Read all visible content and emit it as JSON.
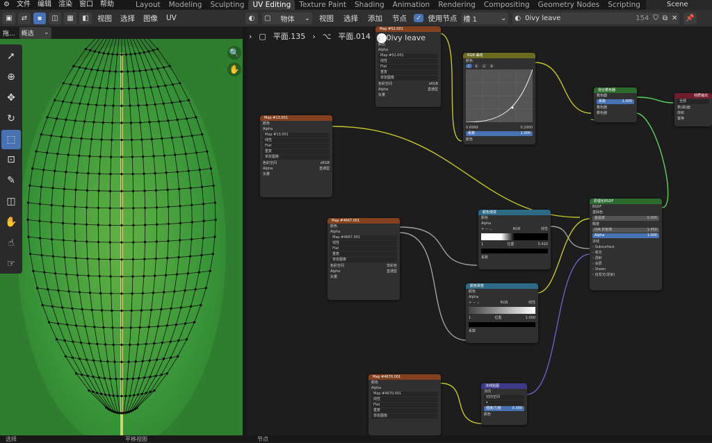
{
  "menu": {
    "items": [
      "文件",
      "编辑",
      "渲染",
      "窗口",
      "帮助"
    ]
  },
  "workspaces": [
    "Layout",
    "Modeling",
    "Sculpting",
    "UV Editing",
    "Texture Paint",
    "Shading",
    "Animation",
    "Rendering",
    "Compositing",
    "Geometry Nodes",
    "Scripting"
  ],
  "active_workspace": "UV Editing",
  "add_tab": "+",
  "scene": "Scene",
  "uv_header": {
    "menus": [
      "视图",
      "选择",
      "图像",
      "UV"
    ]
  },
  "uv_sub": {
    "drag": "拖...",
    "select_mode": "概选"
  },
  "node_header": {
    "object_mode": "物体",
    "menus": [
      "视图",
      "选择",
      "添加",
      "节点"
    ],
    "use_nodes": "使用节点",
    "slot": "槽 1",
    "material": "0ivy leave",
    "users": "154"
  },
  "breadcrumb": {
    "object": "平面.135",
    "mesh": "平面.014",
    "material": "0ivy leave"
  },
  "nodes": {
    "map52": {
      "title": "Map #52.001",
      "image": "Map #52.001",
      "outputs": [
        "颜色",
        "Alpha"
      ],
      "rows": [
        "线性",
        "Flat",
        "重复",
        "单张图像"
      ],
      "colorspace_label": "色彩空间",
      "colorspace": "sRGB",
      "alpha_label": "Alpha",
      "alpha": "直通型",
      "vec": "矢量"
    },
    "rgbcurve": {
      "title": "RGB 曲线",
      "out": "颜色",
      "pos_x": "0.6999",
      "pos_y": "0.2900",
      "fac_label": "系数",
      "fac": "1.000",
      "in": "颜色",
      "channels": [
        "C",
        "R",
        "G",
        "B"
      ]
    },
    "map13": {
      "title": "Map #13.001",
      "image": "Map #13.001",
      "outputs": [
        "颜色",
        "Alpha"
      ],
      "rows": [
        "线性",
        "Flat",
        "重复",
        "单张图像"
      ],
      "colorspace_label": "色彩空间",
      "colorspace": "sRGB",
      "alpha_label": "Alpha",
      "alpha": "直通型",
      "vec": "矢量"
    },
    "mix": {
      "title": "混合着色器",
      "out": "着色器",
      "fac_label": "系数",
      "fac": "1.000",
      "in1": "着色器",
      "in2": "着色器"
    },
    "output": {
      "title": "材质输出",
      "target": "全部",
      "in1": "表(曲)面",
      "in2": "体积",
      "in3": "置换"
    },
    "map4667": {
      "title": "Map #4667.001",
      "image": "Map #4667.001",
      "outputs": [
        "颜色",
        "Alpha"
      ],
      "rows": [
        "线性",
        "Flat",
        "重复",
        "单张图像"
      ],
      "colorspace_label": "色彩空间",
      "colorspace": "非彩色",
      "alpha_label": "Alpha",
      "alpha": "直通型",
      "vec": "矢量"
    },
    "ramp1": {
      "title": "颜色渐变",
      "outputs": [
        "颜色",
        "Alpha"
      ],
      "mode": "RGB",
      "interp": "线性",
      "index": "1",
      "pos_label": "位置",
      "pos": "0.420",
      "in": "系数"
    },
    "ramp2": {
      "title": "颜色渐变",
      "outputs": [
        "颜色",
        "Alpha"
      ],
      "mode": "RGB",
      "interp": "线性",
      "index": "1",
      "pos_label": "位置",
      "pos": "1.000",
      "in": "系数"
    },
    "bsdf": {
      "title": "原理化BSDF",
      "out": "BSDF",
      "in_base": "基础色",
      "metallic_label": "金属度",
      "metallic": "0.000",
      "rough": "糙度",
      "ior_label": "IOR 折射率",
      "ior": "1.450",
      "alpha_label": "Alpha",
      "alpha": "1.000",
      "normal": "法线",
      "panels": [
        "Subsurface",
        "高光",
        "透射",
        "涂层",
        "Sheen",
        "自发光(发射)"
      ]
    },
    "map4670": {
      "title": "Map #4670.001",
      "image": "Map #4670.001",
      "outputs": [
        "颜色",
        "Alpha"
      ],
      "rows": [
        "线性",
        "Flat",
        "重复",
        "单张图像"
      ]
    },
    "normal": {
      "title": "法线贴图",
      "out": "法向",
      "space": "切向空间",
      "strength_label": "强度/力度",
      "strength": "0.300",
      "in": "颜色"
    }
  },
  "status": {
    "left": "选择",
    "mid": "平移视图",
    "right": "节点"
  },
  "colors": {
    "uv_bg": "#2f7e2f",
    "active": "#4772b3"
  }
}
